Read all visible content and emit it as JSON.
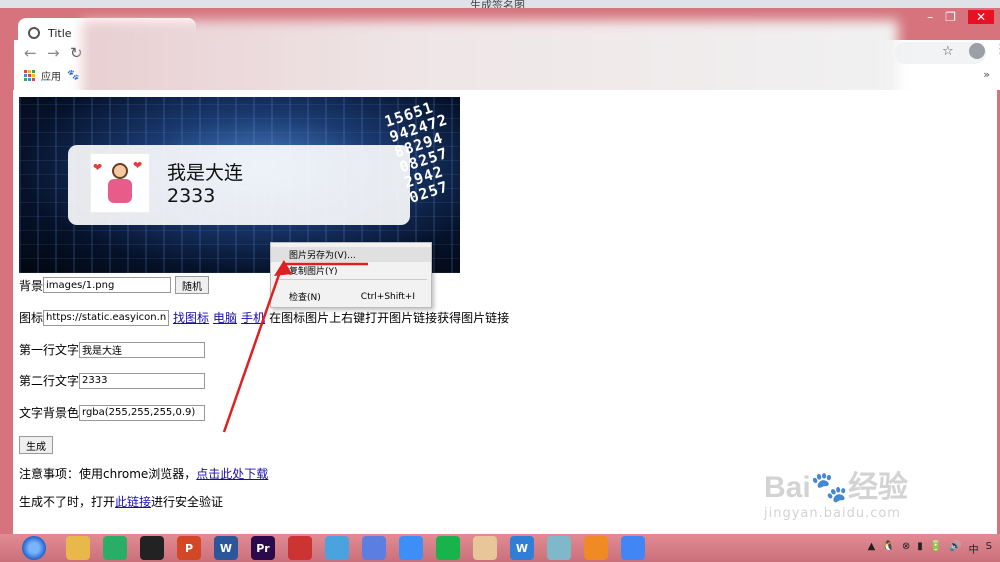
{
  "os": {
    "window_title": "生成签名图",
    "controls": [
      "–",
      "❐",
      "✕"
    ]
  },
  "chrome": {
    "tab_title": "Title",
    "bookmarks": {
      "apps_label": "应用",
      "more": "»"
    },
    "icons": [
      "back-icon",
      "forward-icon",
      "reload-icon",
      "star-icon",
      "profile-icon",
      "menu-icon"
    ]
  },
  "page": {
    "banner": {
      "digits": [
        "15651",
        "942472",
        "88294",
        "08257",
        "2942",
        "0257"
      ],
      "card_line1": "我是大连",
      "card_line2": "2333"
    },
    "form": {
      "bg_label": "背景",
      "bg_value": "images/1.png",
      "random_button": "随机",
      "icon_label": "图标",
      "icon_value": "https://static.easyicon.net/pre",
      "link_find_icon": "找图标",
      "link_computer": "电脑",
      "link_phone": "手机",
      "icon_hint": "在图标图片上右键打开图片链接获得图片链接",
      "line1_label": "第一行文字",
      "line1_value": "我是大连",
      "line2_label": "第二行文字",
      "line2_value": "2333",
      "bgcolor_label": "文字背景色",
      "bgcolor_value": "rgba(255,255,255,0.9)",
      "generate_button": "生成",
      "notice_prefix": "注意事项：使用chrome浏览器，",
      "notice_link": "点击此处下载",
      "fallback_prefix": "生成不了时，打开",
      "fallback_link": "此链接",
      "fallback_suffix": "进行安全验证"
    }
  },
  "context_menu": {
    "items": [
      {
        "label": "图片另存为(V)...",
        "shortcut": ""
      },
      {
        "label": "复制图片(Y)",
        "shortcut": ""
      },
      {
        "label": "检查(N)",
        "shortcut": "Ctrl+Shift+I"
      }
    ]
  },
  "watermark": {
    "main": "Bai🐾经验",
    "sub": "jingyan.baidu.com"
  },
  "taskbar": {
    "apps": [
      {
        "icon": "file-explorer-icon",
        "color": "#e8b84a"
      },
      {
        "icon": "wechat-icon",
        "color": "#2aae67"
      },
      {
        "icon": "qq-icon",
        "color": "#222222"
      },
      {
        "icon": "powerpoint-icon",
        "color": "#d24726",
        "glyph": "P"
      },
      {
        "icon": "word-icon",
        "color": "#2b579a",
        "glyph": "W"
      },
      {
        "icon": "premiere-icon",
        "color": "#2a0a4d",
        "glyph": "Pr"
      },
      {
        "icon": "app-icon",
        "color": "#cc3333"
      },
      {
        "icon": "bird-app-icon",
        "color": "#4aa3df"
      },
      {
        "icon": "arrow-app-icon",
        "color": "#5b7fe0"
      },
      {
        "icon": "baidu-netdisk-icon",
        "color": "#3e8ef7"
      },
      {
        "icon": "green-app-icon",
        "color": "#18b34a"
      },
      {
        "icon": "avatar-app-icon",
        "color": "#e9c59a"
      },
      {
        "icon": "wps-icon",
        "color": "#2f7fd6",
        "glyph": "W"
      },
      {
        "icon": "notes-app-icon",
        "color": "#7fb9c9"
      },
      {
        "icon": "swirl-app-icon",
        "color": "#f08a24"
      },
      {
        "icon": "chrome-icon",
        "color": "#4285f4"
      }
    ],
    "tray": [
      "▲",
      "🐧",
      "⊗",
      "▮",
      "🔋",
      "🔊",
      "中",
      "S"
    ]
  },
  "colors": {
    "frame": "#d6737c",
    "link": "#1a0dab",
    "arrow": "#e02020"
  }
}
